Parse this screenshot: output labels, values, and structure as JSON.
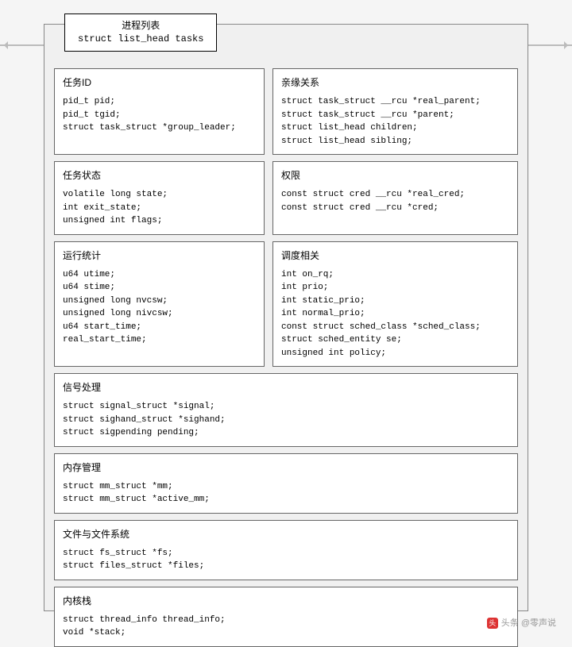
{
  "header": {
    "title_cn": "进程列表",
    "title_code": "struct list_head tasks"
  },
  "boxes": {
    "task_id": {
      "title": "任务ID",
      "code": "pid_t pid;\npid_t tgid;\nstruct task_struct *group_leader;"
    },
    "kinship": {
      "title": "亲缘关系",
      "code": "struct task_struct __rcu *real_parent;\nstruct task_struct __rcu *parent;\nstruct list_head children;\nstruct list_head sibling;"
    },
    "task_state": {
      "title": "任务状态",
      "code": "volatile long state;\nint exit_state;\nunsigned int flags;"
    },
    "perm": {
      "title": "权限",
      "code": "const struct cred __rcu *real_cred;\nconst struct cred __rcu *cred;"
    },
    "run_stats": {
      "title": "运行统计",
      "code": "u64 utime;\nu64 stime;\nunsigned long nvcsw;\nunsigned long nivcsw;\nu64 start_time;\nreal_start_time;"
    },
    "sched": {
      "title": "调度相关",
      "code": "int on_rq;\nint prio;\nint static_prio;\nint normal_prio;\nconst struct sched_class *sched_class;\nstruct sched_entity se;\nunsigned int policy;"
    },
    "signal": {
      "title": "信号处理",
      "code": "struct signal_struct *signal;\nstruct sighand_struct *sighand;\nstruct sigpending pending;"
    },
    "mem": {
      "title": "内存管理",
      "code": "struct mm_struct *mm;\nstruct mm_struct *active_mm;"
    },
    "files": {
      "title": "文件与文件系统",
      "code": "struct fs_struct *fs;\nstruct files_struct *files;"
    },
    "kstack": {
      "title": "内核栈",
      "code": "struct thread_info thread_info;\nvoid *stack;"
    }
  },
  "watermark": "头条 @零声说"
}
